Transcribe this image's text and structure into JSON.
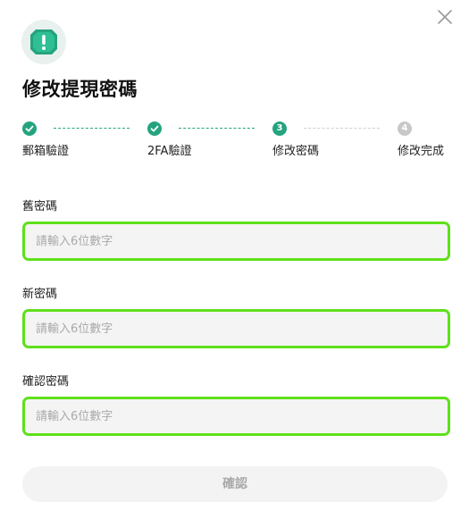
{
  "dialog": {
    "title": "修改提現密碼",
    "icons": {
      "header": "shield-alert-icon",
      "close": "close-icon"
    },
    "colors": {
      "accent": "#25a37f",
      "highlight_border": "#5fe01a",
      "step_todo": "#c8c8c8"
    }
  },
  "steps": [
    {
      "label": "郵箱驗證",
      "state": "done",
      "marker": ""
    },
    {
      "label": "2FA驗證",
      "state": "done",
      "marker": ""
    },
    {
      "label": "修改密碼",
      "state": "current",
      "marker": "3"
    },
    {
      "label": "修改完成",
      "state": "todo",
      "marker": "4"
    }
  ],
  "fields": {
    "old_password": {
      "label": "舊密碼",
      "placeholder": "請輸入6位數字",
      "value": ""
    },
    "new_password": {
      "label": "新密碼",
      "placeholder": "請輸入6位數字",
      "value": ""
    },
    "confirm_password": {
      "label": "確認密碼",
      "placeholder": "請輸入6位數字",
      "value": ""
    }
  },
  "confirm_button": {
    "label": "確認"
  }
}
